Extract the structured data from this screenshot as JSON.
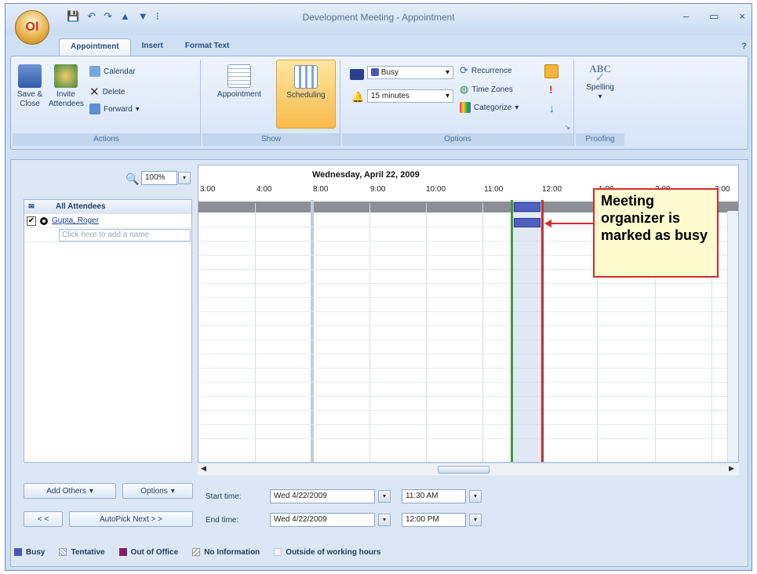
{
  "window": {
    "title": "Development Meeting - Appointment",
    "minimize": "–",
    "maximize": "▭",
    "close": "×"
  },
  "orb_letter": "Ol",
  "tabs": [
    "Appointment",
    "Insert",
    "Format Text"
  ],
  "ribbon": {
    "actions": {
      "label": "Actions",
      "save_close": "Save & Close",
      "invite_attendees": "Invite Attendees",
      "calendar": "Calendar",
      "delete": "Delete",
      "forward": "Forward"
    },
    "show": {
      "label": "Show",
      "appointment": "Appointment",
      "scheduling": "Scheduling"
    },
    "options": {
      "label": "Options",
      "show_as": "Busy",
      "reminder": "15 minutes",
      "recurrence": "Recurrence",
      "time_zones": "Time Zones",
      "categorize": "Categorize"
    },
    "proofing": {
      "label": "Proofing",
      "spelling": "Spelling",
      "spelling_icon_text": "ABC"
    }
  },
  "scheduling": {
    "zoom": "100%",
    "date_header": "Wednesday, April 22, 2009",
    "hours": [
      "3:00",
      "4:00",
      "8:00",
      "9:00",
      "10:00",
      "11:00",
      "12:00",
      "1:00",
      "2:00",
      "3:00"
    ],
    "all_attendees": "All Attendees",
    "attendees": [
      {
        "name": "Gupta, Roger",
        "checked": true
      }
    ],
    "add_name_placeholder": "Click here to add a name"
  },
  "callout": "Meeting organizer is marked as busy",
  "footer": {
    "add_others": "Add Others",
    "options": "Options",
    "prev": "< <",
    "autopick": "AutoPick Next > >",
    "start_label": "Start time:",
    "end_label": "End time:",
    "start_date": "Wed 4/22/2009",
    "start_time": "11:30 AM",
    "end_date": "Wed 4/22/2009",
    "end_time": "12:00 PM"
  },
  "legend": {
    "busy": "Busy",
    "tentative": "Tentative",
    "out_of_office": "Out of Office",
    "no_information": "No Information",
    "outside_hours": "Outside of working hours"
  },
  "colors": {
    "busy": "#4a55b8",
    "out_of_office": "#7a1f6e",
    "callout_border": "#d92a2a",
    "selection_start": "#3e9b3e",
    "selection_end": "#c0312f"
  }
}
